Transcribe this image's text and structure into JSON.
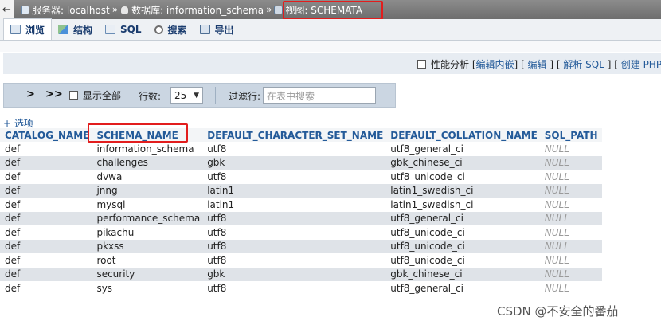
{
  "breadcrumb": {
    "back": "←",
    "server_label": "服务器: localhost",
    "database_label": "数据库: information_schema",
    "view_label": "视图: SCHEMATA",
    "separator": "»"
  },
  "tabs": [
    {
      "label": "浏览",
      "icon": "browse-icon",
      "active": true
    },
    {
      "label": "结构",
      "icon": "structure-icon",
      "active": false
    },
    {
      "label": "SQL",
      "icon": "sql-icon",
      "active": false
    },
    {
      "label": "搜索",
      "icon": "search-icon",
      "active": false
    },
    {
      "label": "导出",
      "icon": "export-icon",
      "active": false
    }
  ],
  "profiling": {
    "checkbox_label": "性能分析",
    "inline_edit": "编辑内嵌",
    "edit": "编辑",
    "explain_sql": "解析 SQL",
    "create_php": "创建 PHP 代码"
  },
  "navigation": {
    "next": ">",
    "last": ">>",
    "show_all_label": "显示全部",
    "rows_label": "行数:",
    "rows_value": "25",
    "filter_label": "过滤行:",
    "filter_placeholder": "在表中搜索"
  },
  "options_link": "+ 选项",
  "table": {
    "headers": [
      "CATALOG_NAME",
      "SCHEMA_NAME",
      "DEFAULT_CHARACTER_SET_NAME",
      "DEFAULT_COLLATION_NAME",
      "SQL_PATH"
    ],
    "rows": [
      [
        "def",
        "information_schema",
        "utf8",
        "utf8_general_ci",
        "NULL"
      ],
      [
        "def",
        "challenges",
        "gbk",
        "gbk_chinese_ci",
        "NULL"
      ],
      [
        "def",
        "dvwa",
        "utf8",
        "utf8_unicode_ci",
        "NULL"
      ],
      [
        "def",
        "jnng",
        "latin1",
        "latin1_swedish_ci",
        "NULL"
      ],
      [
        "def",
        "mysql",
        "latin1",
        "latin1_swedish_ci",
        "NULL"
      ],
      [
        "def",
        "performance_schema",
        "utf8",
        "utf8_general_ci",
        "NULL"
      ],
      [
        "def",
        "pikachu",
        "utf8",
        "utf8_unicode_ci",
        "NULL"
      ],
      [
        "def",
        "pkxss",
        "utf8",
        "utf8_unicode_ci",
        "NULL"
      ],
      [
        "def",
        "root",
        "utf8",
        "utf8_unicode_ci",
        "NULL"
      ],
      [
        "def",
        "security",
        "gbk",
        "gbk_chinese_ci",
        "NULL"
      ],
      [
        "def",
        "sys",
        "utf8",
        "utf8_general_ci",
        "NULL"
      ]
    ]
  },
  "watermark": "CSDN @不安全的番茄",
  "colors": {
    "highlight_box": "#e21d1d",
    "link": "#235a99",
    "row_alt": "#dfe3e8"
  }
}
